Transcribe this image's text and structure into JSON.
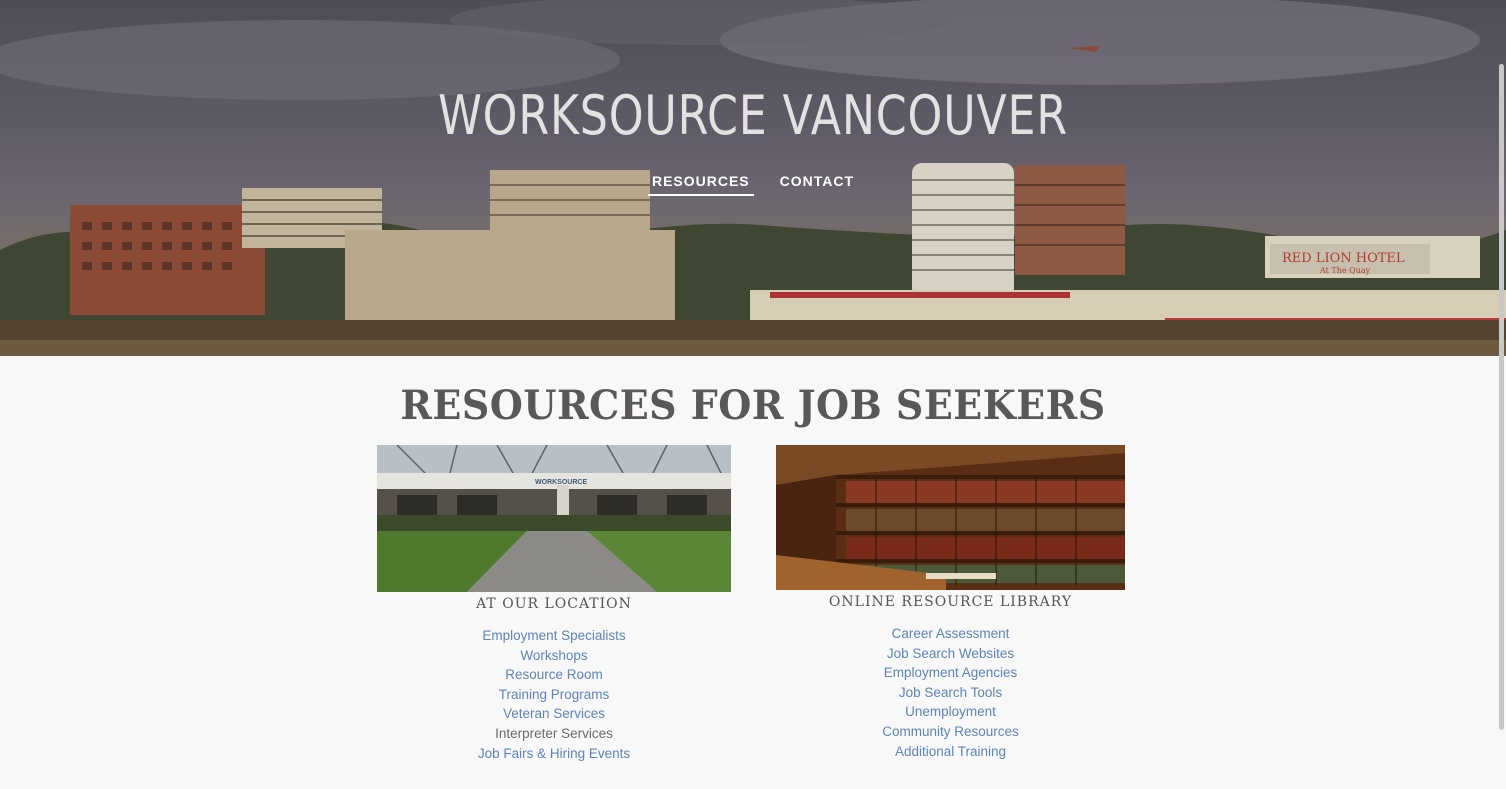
{
  "header": {
    "site_title": "WORKSOURCE VANCOUVER",
    "nav": [
      {
        "label": "RESOURCES",
        "active": true
      },
      {
        "label": "CONTACT",
        "active": false
      }
    ],
    "hero_sign_text": "RED LION HOTEL",
    "hero_sign_subtext": "At The Quay"
  },
  "main": {
    "title": "RESOURCES FOR JOB SEEKERS",
    "columns": [
      {
        "heading": "AT OUR LOCATION",
        "sign_text": "WORKSOURCE",
        "links": [
          {
            "label": "Employment Specialists",
            "link": true
          },
          {
            "label": "Workshops",
            "link": true
          },
          {
            "label": "Resource Room",
            "link": true
          },
          {
            "label": "Training Programs",
            "link": true
          },
          {
            "label": "Veteran Services",
            "link": true
          },
          {
            "label": "Interpreter Services",
            "link": false
          },
          {
            "label": "Job Fairs & Hiring Events",
            "link": true
          }
        ]
      },
      {
        "heading": "ONLINE RESOURCE LIBRARY",
        "links": [
          {
            "label": "Career Assessment",
            "link": true
          },
          {
            "label": "Job Search Websites",
            "link": true
          },
          {
            "label": "Employment Agencies",
            "link": true
          },
          {
            "label": "Job Search Tools",
            "link": true
          },
          {
            "label": "Unemployment",
            "link": true
          },
          {
            "label": "Community Resources",
            "link": true
          },
          {
            "label": "Additional Training",
            "link": true
          }
        ]
      }
    ]
  },
  "colors": {
    "link": "#5d84b6",
    "heading": "#5a5757",
    "background": "#f8f8f8"
  }
}
